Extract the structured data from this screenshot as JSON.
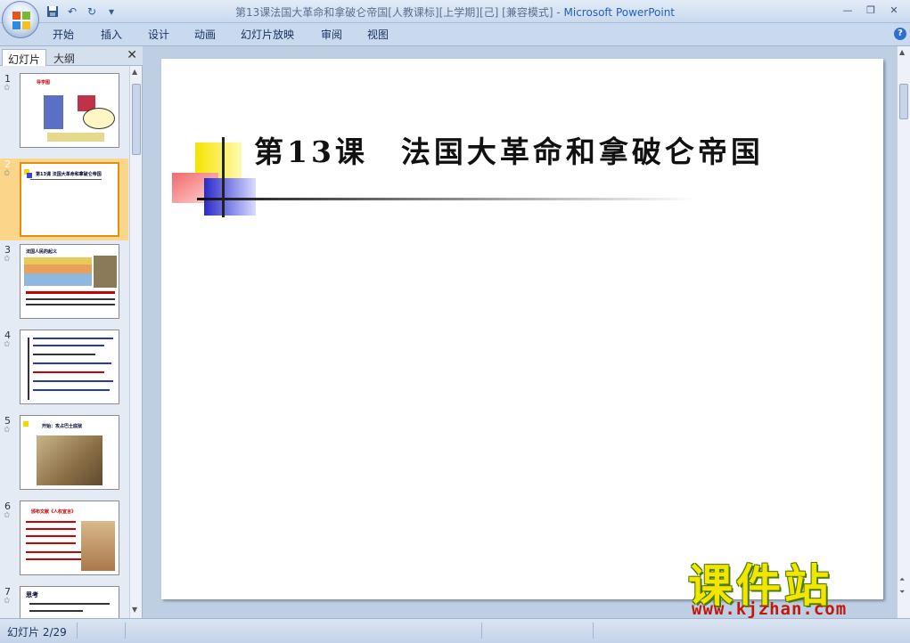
{
  "window": {
    "title": "第13课法国大革命和拿破仑帝国[人教课标][上学期][己] [兼容模式]",
    "separator": "-",
    "app_name": "Microsoft PowerPoint"
  },
  "quick_access": [
    "save-icon",
    "undo-icon",
    "redo-icon",
    "customize-icon"
  ],
  "ribbon": {
    "tabs": [
      "开始",
      "插入",
      "设计",
      "动画",
      "幻灯片放映",
      "审阅",
      "视图"
    ]
  },
  "left_pane": {
    "tab_slides": "幻灯片",
    "tab_outline": "大纲",
    "thumbnails": [
      {
        "num": "1",
        "caption": "导学图"
      },
      {
        "num": "2",
        "caption": "第13课 法国大革命和拿破仑帝国"
      },
      {
        "num": "3",
        "caption": "法国人民的起义"
      },
      {
        "num": "4",
        "caption": ""
      },
      {
        "num": "5",
        "caption": "开始：攻占巴士底狱"
      },
      {
        "num": "6",
        "caption": "颁布文献《人权宣言》"
      },
      {
        "num": "7",
        "caption": "思考"
      }
    ],
    "selected_index": 1
  },
  "slide": {
    "title": "第13课　法国大革命和拿破仑帝国"
  },
  "status": {
    "slide_counter": "幻灯片 2/29"
  },
  "watermark": {
    "main": "课件站",
    "url": "www.kjzhan.com"
  }
}
